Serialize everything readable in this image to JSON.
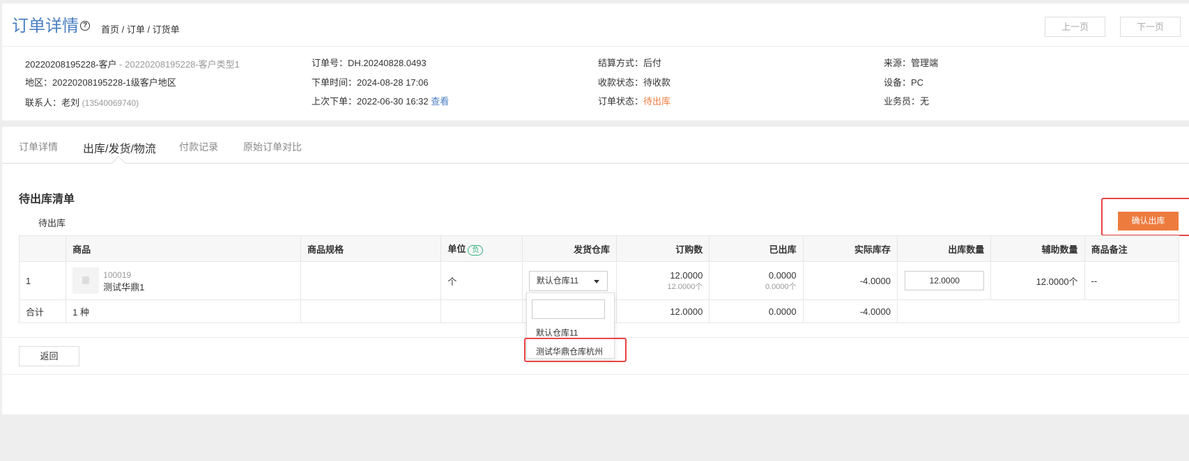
{
  "header": {
    "title": "订单详情",
    "breadcrumb": "首页 / 订单 / 订货单",
    "prev_label": "上一页",
    "next_label": "下一页"
  },
  "info": {
    "customer": "20220208195228-客户",
    "customer_type": " - 20220208195228-客户类型1",
    "region": "地区：20220208195228-1级客户地区",
    "contact_label": "联系人：",
    "contact_name": "老刘",
    "contact_phone": "(13540069740)",
    "order_no": "订单号：DH.20240828.0493",
    "order_time": "下单时间：2024-08-28 17:06",
    "last_order": "上次下单：2022-06-30 16:32",
    "last_order_link": "查看",
    "settle": "结算方式：后付",
    "payment_status": "收款状态：待收款",
    "order_status_label": "订单状态：",
    "order_status": "待出库",
    "source": "来源：管理端",
    "device": "设备：PC",
    "salesman": "业务员：无"
  },
  "tabs": [
    "订单详情",
    "出库/发货/物流",
    "付款记录",
    "原始订单对比"
  ],
  "section": {
    "title": "待出库清单",
    "sub_label": "待出库",
    "confirm_label": "确认出库"
  },
  "table": {
    "headers": [
      "",
      "商品",
      "商品规格",
      "单位",
      "发货仓库",
      "订购数",
      "已出库",
      "实际库存",
      "出库数量",
      "辅助数量",
      "商品备注"
    ],
    "unit_badge": "负",
    "row": {
      "index": "1",
      "product_code": "100019",
      "product_name": "测试华鼎1",
      "spec": "",
      "unit": "个",
      "warehouse": "默认仓库11",
      "ordered": "12.0000",
      "ordered_sub": "12.0000个",
      "shipped": "0.0000",
      "shipped_sub": "0.0000个",
      "stock": "-4.0000",
      "out_qty": "12.0000",
      "aux_qty": "12.0000个",
      "remark": "--"
    },
    "total": {
      "label": "合计",
      "kinds": "1 种",
      "ordered": "12.0000",
      "shipped": "0.0000",
      "stock": "-4.0000"
    }
  },
  "dropdown": {
    "search_placeholder": "",
    "options": [
      "默认仓库11",
      "测试华鼎仓库杭州"
    ]
  },
  "footer": {
    "back_label": "返回"
  },
  "colors": {
    "accent": "#4a7fc1",
    "orange": "#ee7b3e",
    "highlight": "#e84545"
  }
}
